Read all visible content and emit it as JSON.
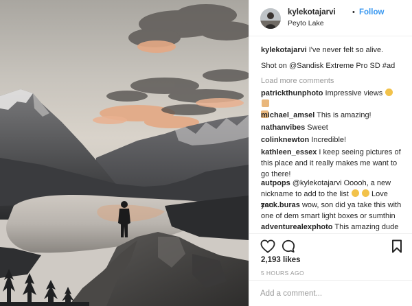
{
  "post": {
    "username": "kylekotajarvi",
    "follow_label": "Follow",
    "location": "Peyto Lake",
    "separator": "•"
  },
  "caption": {
    "username": "kylekotajarvi",
    "text": "I've never felt so alive.",
    "text2": "Shot on @Sandisk Extreme Pro SD #ad"
  },
  "load_more_label": "Load more comments",
  "comments": [
    {
      "username": "patrickthunphoto",
      "text": "Impressive views",
      "emoji": [
        "smiling-face-with-sunglasses",
        "thumbs-up",
        "thumbs-up"
      ]
    },
    {
      "username": "michael_amsel",
      "text": "This is amazing!"
    },
    {
      "username": "nathanvibes",
      "text": "Sweet"
    },
    {
      "username": "colinknewton",
      "text": "Incredible!"
    },
    {
      "username": "kathleen_essex",
      "text": "I keep seeing pictures of this place and it really makes me want to go there!"
    },
    {
      "username": "autpops",
      "text": "@kylekotajarvi Ooooh, a new nickname to add to the list",
      "text_after": "Love you",
      "emoji": [
        "grinning-face-with-sweat",
        "smiling-face-with-sunglasses"
      ]
    },
    {
      "username": "zack.buras",
      "text": "wow, son did ya take this with one of dem smart light boxes or sumthin"
    },
    {
      "username": "adventurealexphoto",
      "text": "This amazing dude"
    }
  ],
  "likes_label": "2,193 likes",
  "timestamp": "5 HOURS AGO",
  "add_comment_placeholder": "Add a comment...",
  "colors": {
    "link_blue": "#3897f0",
    "muted": "#999999",
    "text": "#262626",
    "border": "#efefef"
  },
  "icons": [
    "heart-outline-icon",
    "comment-bubble-icon",
    "bookmark-icon"
  ]
}
